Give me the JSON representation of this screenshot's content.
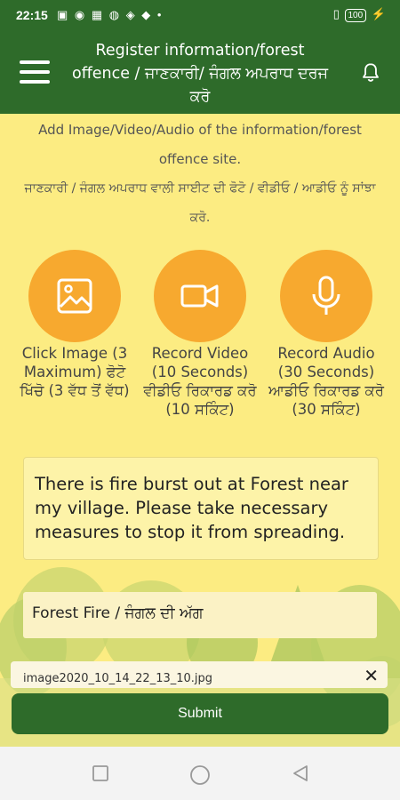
{
  "status_bar": {
    "time": "22:15",
    "battery": "100"
  },
  "app_bar": {
    "title": "Register information/forest offence / ਜਾਣਕਾਰੀ/ ਜੰਗਲ ਅਪਰਾਧ ਦਰਜ ਕਰੋ",
    "menu_icon": "hamburger-menu-icon",
    "notification_icon": "bell-icon"
  },
  "intro": {
    "english": "Add Image/Video/Audio of the information/forest offence site.",
    "punjabi": "ਜਾਣਕਾਰੀ / ਜੰਗਲ ਅਪਰਾਧ ਵਾਲੀ ਸਾਈਟ ਦੀ ਫੋਟੋ / ਵੀਡੀਓ / ਆਡੀਓ ਨੂੰ ਸਾਂਝਾ ਕਰੋ."
  },
  "media_buttons": [
    {
      "icon": "image-icon",
      "label": "Click Image (3 Maximum) ਫੋਟੋ ਖਿੱਚੋ (3 ਵੱਧ ਤੋਂ ਵੱਧ)"
    },
    {
      "icon": "video-camera-icon",
      "label": "Record Video (10 Seconds) ਵੀਡੀਓ ਰਿਕਾਰਡ ਕਰੋ (10 ਸਕਿੰਟ)"
    },
    {
      "icon": "microphone-icon",
      "label": "Record Audio (30 Seconds) ਆਡੀਓ ਰਿਕਾਰਡ ਕਰੋ (30 ਸਕਿੰਟ)"
    }
  ],
  "description": "There is fire burst out at Forest near my village. Please take necessary measures to stop it from spreading.",
  "category": "Forest Fire / ਜੰਗਲ ਦੀ ਅੱਗ",
  "attachment": {
    "filename": "image2020_10_14_22_13_10.jpg",
    "close_label": "✕"
  },
  "submit_label": "Submit",
  "colors": {
    "header": "#2e6b2a",
    "background": "#fcec82",
    "accent": "#f7a92f"
  }
}
